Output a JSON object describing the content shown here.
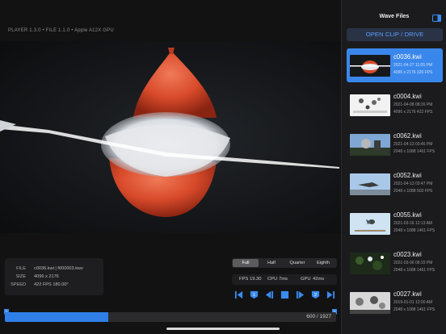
{
  "player": {
    "version_info": "PLAYER 1.3.0  •  FILE 1.1.0  •  Apple A12X GPU",
    "file_info": {
      "file_label": "FILE",
      "file_value": "c0036.kwi | f000003.kwv",
      "size_label": "SIZE",
      "size_value": "4096 x 2176",
      "speed_label": "SPEED",
      "speed_value": "422 FPS 180.00°"
    },
    "scale_options": [
      "Full",
      "Half",
      "Quarter",
      "Eighth"
    ],
    "scale_selected": "Full",
    "stats": {
      "fps_label": "FPS",
      "fps_value": "19.30",
      "cpu_label": "CPU",
      "cpu_value": "7ms",
      "gpu_label": "GPU",
      "gpu_value": "42ms"
    },
    "transport": {
      "icons": [
        "skip-to-start-icon",
        "marker-1-icon",
        "step-back-icon",
        "stop-icon",
        "step-forward-icon",
        "marker-2-icon",
        "skip-to-end-icon"
      ],
      "marker_1_label": "1",
      "marker_2_label": "2"
    },
    "scrubber": {
      "current_frame": 600,
      "total_frames": 1927,
      "readout": "600 / 1927",
      "start_marker_label": "1",
      "end_marker_label": "2"
    },
    "accent_color": "#2f7fe6"
  },
  "sidebar": {
    "title": "Wave Files",
    "open_button": "OPEN CLIP / DRIVE",
    "files": [
      {
        "name": "c0036.kwi",
        "date": "2021-04-27 11:05 PM",
        "meta": "4096 x 2176  320 FPS",
        "selected": true
      },
      {
        "name": "c0004.kwi",
        "date": "2021-04-08 08:26 PM",
        "meta": "4096 x 2176  422 FPS",
        "selected": false
      },
      {
        "name": "c0062.kwi",
        "date": "2021-04-13 03:46 PM",
        "meta": "2048 x 1088  1461 FPS",
        "selected": false
      },
      {
        "name": "c0052.kwi",
        "date": "2021-04-13 03:47 PM",
        "meta": "2048 x 1088  503 FPS",
        "selected": false
      },
      {
        "name": "c0055.kwi",
        "date": "2021-03-16 12:13 AM",
        "meta": "2048 x 1088  1461 FPS",
        "selected": false
      },
      {
        "name": "c0023.kwi",
        "date": "2021-03-06 06:15 PM",
        "meta": "2048 x 1088  1461 FPS",
        "selected": false
      },
      {
        "name": "c0027.kwi",
        "date": "2019-01-01 12:00 AM",
        "meta": "2048 x 1088  1461 FPS",
        "selected": false
      }
    ]
  }
}
